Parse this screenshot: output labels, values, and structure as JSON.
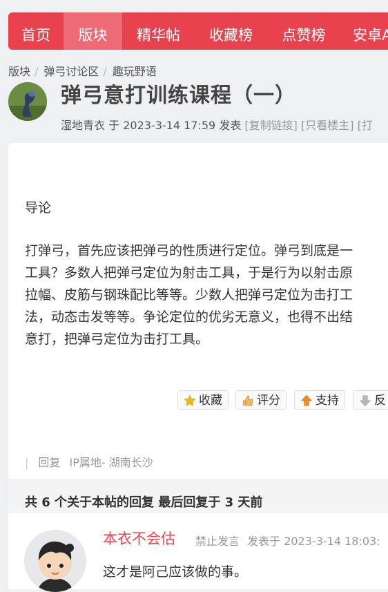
{
  "nav": {
    "items": [
      {
        "label": "首页"
      },
      {
        "label": "版块"
      },
      {
        "label": "精华帖"
      },
      {
        "label": "收藏榜"
      },
      {
        "label": "点赞榜"
      },
      {
        "label": "安卓A"
      }
    ],
    "active_index": 1,
    "color": "#e8424f"
  },
  "breadcrumb": [
    "版块",
    "弹弓讨论区",
    "趣玩野语"
  ],
  "post": {
    "title": "弹弓意打训练课程（一）",
    "author": "湿地青衣",
    "posted_prefix": "于",
    "date": "2023-3-14 17:59",
    "posted_suffix": "发表",
    "links": [
      "[复制链接]",
      "[只看楼主]",
      "[打"
    ],
    "heading": "导论",
    "body_lines": [
      "打弹弓，首先应该把弹弓的性质进行定位。弹弓到底是一",
      "工具？多数人把弹弓定位为射击工具，于是行为以射击原",
      "拉幅、皮筋与钢珠配比等等。少数人把弹弓定位为击打工",
      "法，动态击发等等。争论定位的优劣无意义，也得不出结",
      "意打，把弹弓定位为击打工具。"
    ],
    "actions": [
      {
        "label": "收藏",
        "icon": "star-icon"
      },
      {
        "label": "评分",
        "icon": "thumb-up-icon"
      },
      {
        "label": "支持",
        "icon": "arrow-up-icon"
      },
      {
        "label": "反",
        "icon": "arrow-down-icon"
      }
    ],
    "reply_label": "回复",
    "ip_location": "IP属地- 湖南长沙"
  },
  "replies_summary": "共 6 个关于本帖的回复 最后回复于 3 天前",
  "first_reply": {
    "user": "本衣不会估",
    "status": "禁止发言",
    "time": "发表于 2023-3-14 18:03:",
    "text": "这才是阿己应该做的事。"
  }
}
